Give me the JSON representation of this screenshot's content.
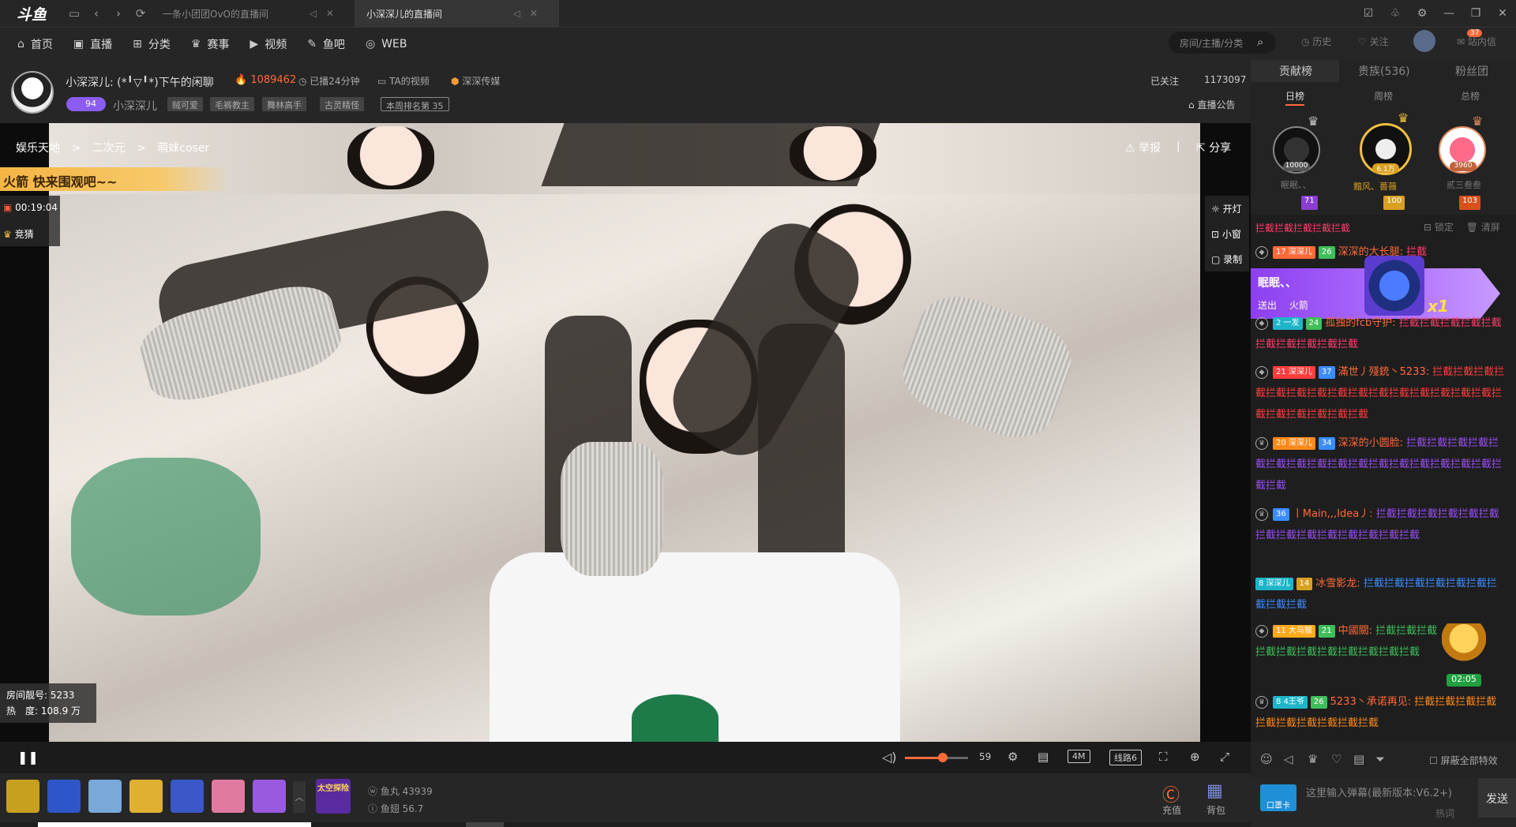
{
  "app": {
    "logo_text": "斗鱼"
  },
  "tabs": [
    {
      "label": "一条小团团OvO的直播间",
      "active": false
    },
    {
      "label": "小深深儿的直播间",
      "active": true
    }
  ],
  "nav": {
    "items": [
      "首页",
      "直播",
      "分类",
      "赛事",
      "视频",
      "鱼吧",
      "WEB"
    ],
    "search_placeholder": "房间/主播/分类",
    "history": "历史",
    "follow": "关注",
    "msg": "站内信",
    "msg_count": "37"
  },
  "room": {
    "title": "小深深儿: (*╹▽╹*)下午的闲聊",
    "heat": "1089462",
    "streamed": "已播24分钟",
    "ta_video": "TA的视频",
    "guild": "深深传媒",
    "level": "94",
    "username": "小深深儿",
    "tags": [
      "贼可爱",
      "毛裤教主",
      "舞林高手",
      "古灵精怪"
    ],
    "rank_tag": "本周排名第 35",
    "followed": "已关注",
    "followers": "1173097",
    "announcement": "直播公告"
  },
  "player": {
    "breadcrumb": [
      "娱乐天地",
      ">",
      "二次元",
      ">",
      "萌妹coser"
    ],
    "report": "举报",
    "share": "分享",
    "banner": "火箭 快来围观吧~~",
    "timer": "00:19:04",
    "guess": "竞猜",
    "right_buttons": [
      "开灯",
      "小窗",
      "录制"
    ],
    "room_id_label": "房间靓号:",
    "room_id": "5233",
    "heat_label": "热　度:",
    "heat": "108.9 万",
    "volume": 59,
    "volume_level": 0.6,
    "quality": "4M",
    "line": "线路6"
  },
  "giftbar": {
    "gifts": [
      "gift-1",
      "gift-2",
      "gift-3",
      "gift-4",
      "gift-5",
      "gift-6",
      "gift-7"
    ],
    "special": "太空探险",
    "fish_balls": "鱼丸 43939",
    "fish_fins": "鱼翅 56.7",
    "recharge": "充值",
    "backpack": "背包"
  },
  "rank": {
    "tabs": [
      "贡献榜",
      "贵族(536)",
      "粉丝团"
    ],
    "periods": [
      "日榜",
      "周榜",
      "总榜"
    ],
    "top": [
      {
        "name": "眠眠、、",
        "score": "10000",
        "badge": "71"
      },
      {
        "name": "黯风、薔薇",
        "score": "6.1万",
        "badge": "100"
      },
      {
        "name": "贰三叁叁",
        "score": "3960",
        "badge": "103"
      }
    ]
  },
  "chat": {
    "lock": "锁定",
    "clear": "清屏",
    "messages": [
      {
        "text": "拦截拦截拦截拦截拦截",
        "color": "#ff3d6b"
      },
      {
        "fan": "17 深深儿",
        "lvl": "26",
        "user": "深深的大长腿:",
        "text": "拦截",
        "color": "#ff3d6b"
      },
      {
        "fan": "2 一发",
        "lvl": "24",
        "user": "孤独的fcb守护:",
        "text": "拦截拦截拦截拦截拦截拦截拦截拦截拦截拦截",
        "color": "#ff3d6b"
      },
      {
        "fan": "21 深深儿",
        "lvl": "37",
        "user": "滿世丿殘銃丶5233:",
        "text": "拦截拦截拦截拦截拦截拦截拦截拦截拦截拦截拦截拦截拦截拦截拦截拦截拦截拦截拦截拦截拦截",
        "color": "#ff3d6b"
      },
      {
        "fan": "20 深深儿",
        "lvl": "34",
        "user": "深深的小圆脸:",
        "text": "拦截拦截拦截拦截拦截拦截拦截拦截拦截拦截拦截拦截拦截拦截拦截拦截拦截拦截",
        "color": "#9a4df5"
      },
      {
        "fan": "",
        "lvl": "36",
        "user": "丨Main,,,Idea丿:",
        "text": "拦截拦截拦截拦截拦截拦截拦截拦截拦截拦截拦截拦截拦截拦截",
        "color": "#9a4df5"
      },
      {
        "fan": "8 深深儿",
        "lvl": "14",
        "user": "冰雪影龙:",
        "text": "拦截拦截拦截拦截拦截拦截拦截拦截拦截",
        "color": "#3b8cff"
      },
      {
        "fan": "11 大马猴",
        "lvl": "21",
        "user": "中國關:",
        "text": "拦截拦截拦截拦截拦截拦截拦截拦截拦截拦截拦截",
        "color": "#3fbf5a"
      },
      {
        "fan": "8 4王爷",
        "lvl": "26",
        "user": "5233丶承诺再见:",
        "text": "拦截拦截拦截拦截拦截拦截拦截拦截拦截拦截",
        "color": "#ff8a1a"
      }
    ],
    "gift_popup": {
      "name": "眠眠、、",
      "sent": "送出",
      "gift": "火箭",
      "count": "x1"
    },
    "chest_timer": "02:05",
    "shield_label": "屏蔽全部特效",
    "card": "口罩卡",
    "input_placeholder": "这里输入弹幕(最新版本:V6.2+)",
    "hot_word": "热词",
    "send": "发送"
  },
  "colors": {
    "accent": "#ff6a3a",
    "bg": "#1e1e1e",
    "panel": "#262626"
  }
}
